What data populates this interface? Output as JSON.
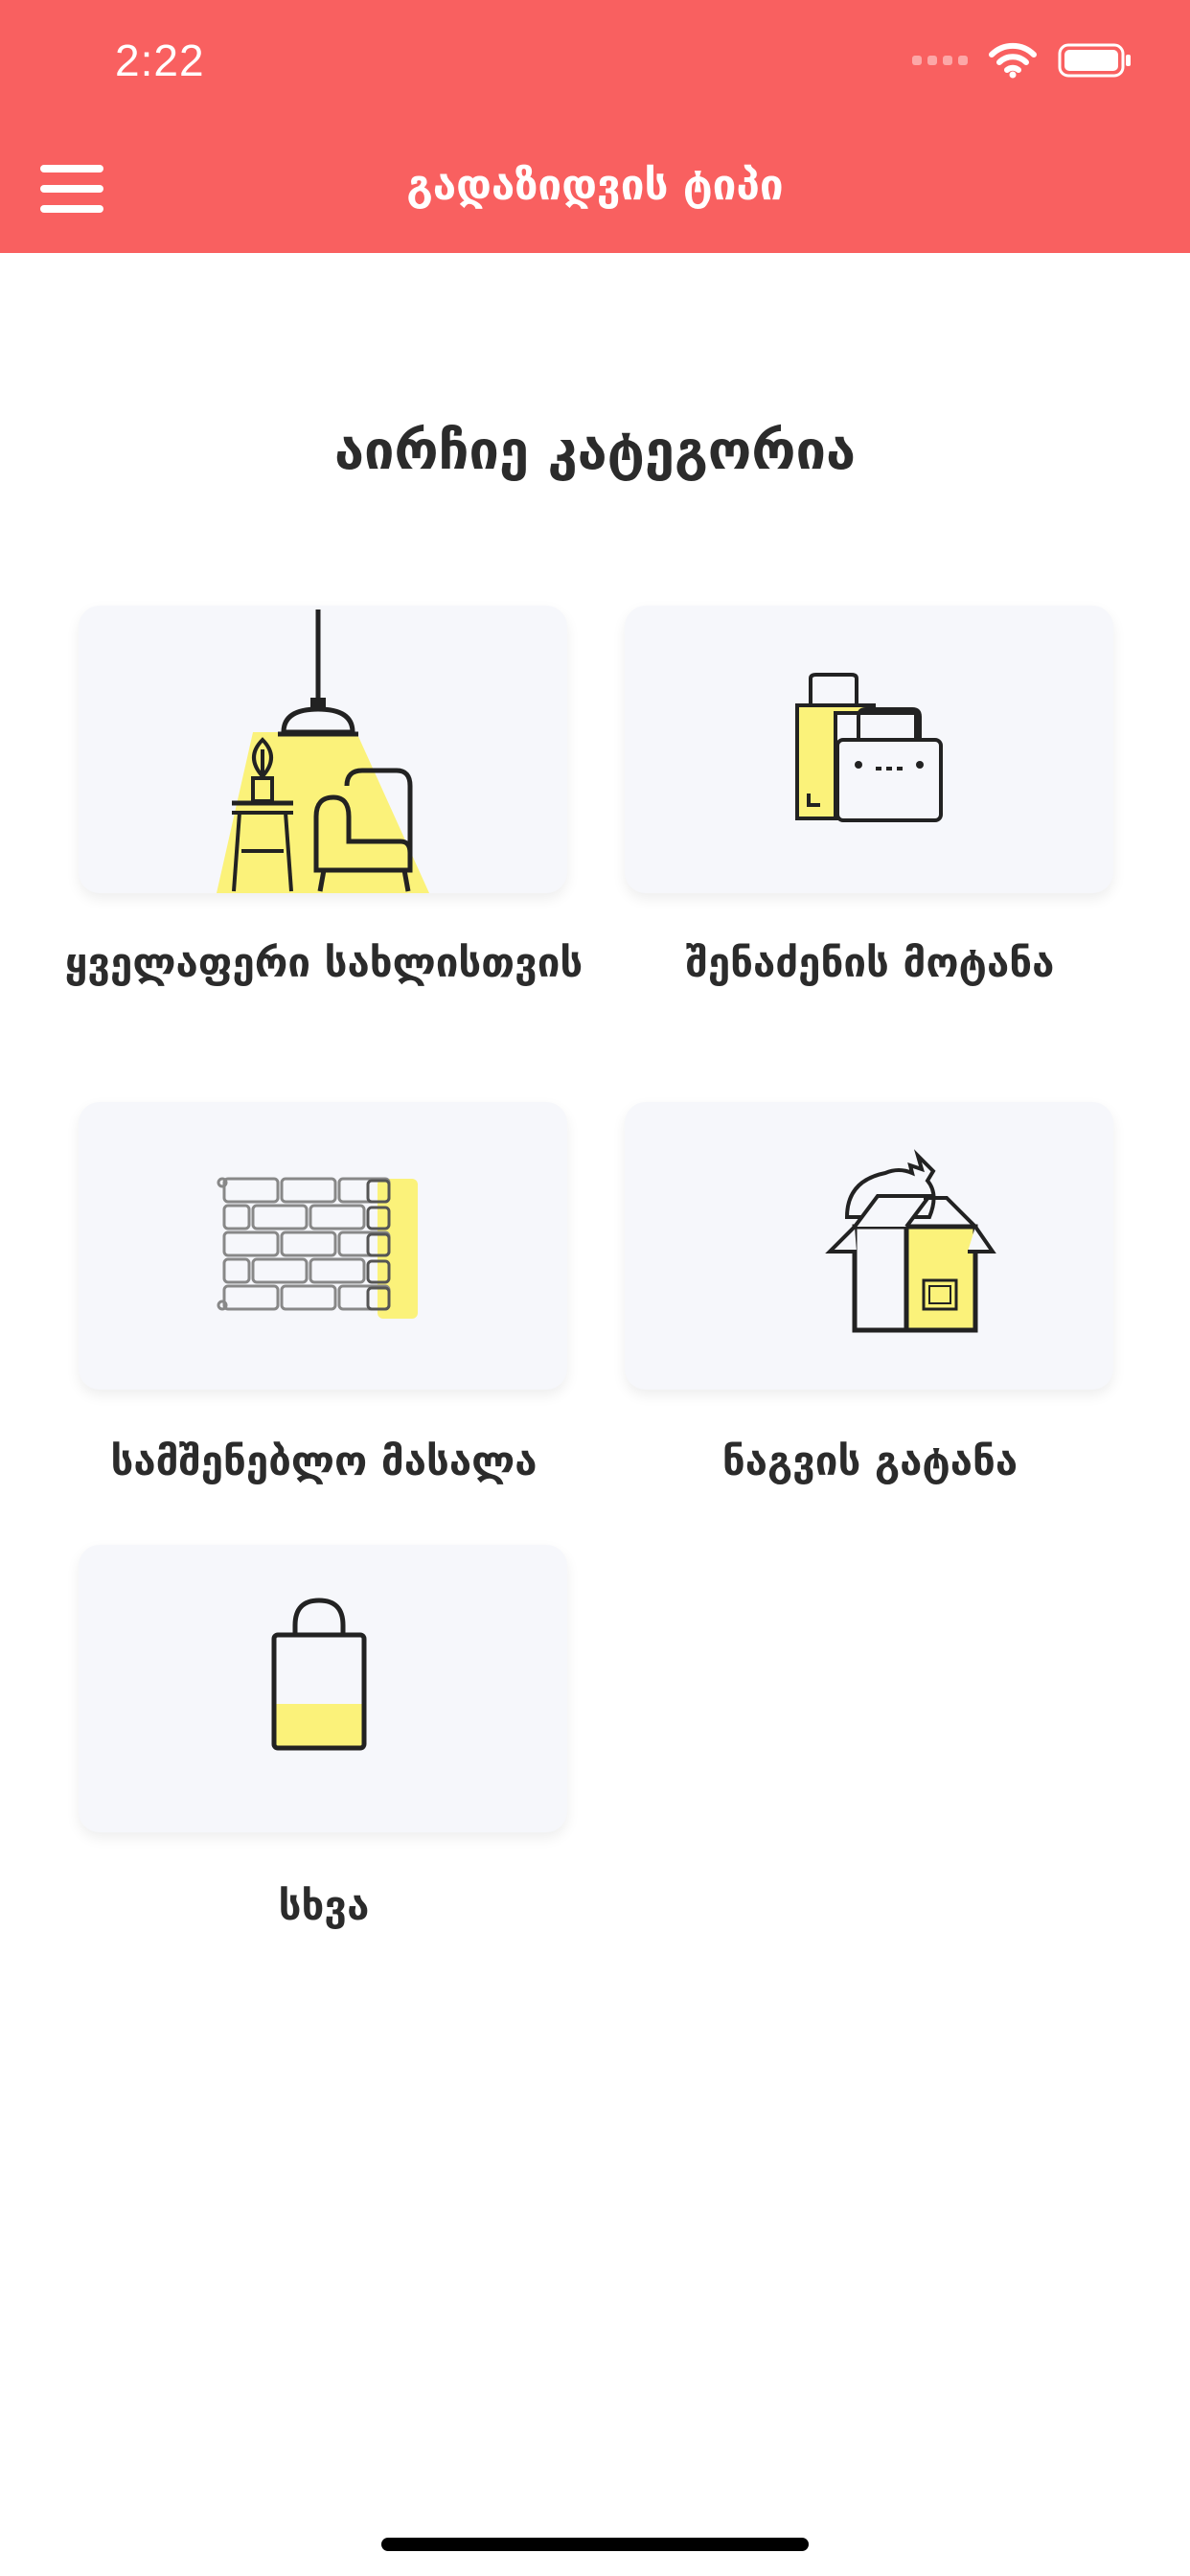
{
  "status_bar": {
    "time": "2:22"
  },
  "nav": {
    "title": "გადაზიდვის ტიპი"
  },
  "page": {
    "heading": "აირჩიე კატეგორია"
  },
  "categories": [
    {
      "label": "ყველაფერი სახლისთვის",
      "icon": "lamp-furniture-icon"
    },
    {
      "label": "შენაძენის მოტანა",
      "icon": "shopping-bags-icon"
    },
    {
      "label": "სამშენებლო მასალა",
      "icon": "brick-wall-icon"
    },
    {
      "label": "ნაგვის გატანა",
      "icon": "trash-box-icon"
    },
    {
      "label": "სხვა",
      "icon": "shopping-bag-icon"
    }
  ],
  "colors": {
    "header": "#f96060",
    "accent_yellow": "#fbf27a",
    "card_bg": "#f6f7fb"
  }
}
